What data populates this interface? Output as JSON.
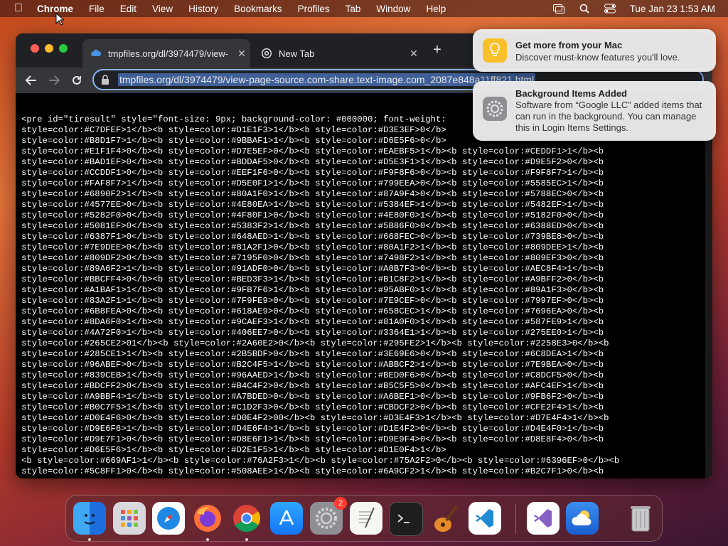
{
  "menubar": {
    "app": "Chrome",
    "items": [
      "File",
      "Edit",
      "View",
      "History",
      "Bookmarks",
      "Profiles",
      "Tab",
      "Window",
      "Help"
    ],
    "clock": "Tue Jan 23  1:53 AM"
  },
  "browser": {
    "tabs": [
      {
        "title": "tmpfiles.org/dl/3974479/view-",
        "close": "✕"
      },
      {
        "title": "New Tab",
        "close": "✕"
      }
    ],
    "new_tab": "+",
    "url": "tmpfiles.org/dl/3974479/view-page-source.com-share.text-image.com_2087e848a11ff821.html"
  },
  "source_lines": [
    "<pre id=\"tiresult\" style=\"font-size: 9px; background-color: #000000; font-weight:",
    "style=color:#C7DFEF>1</b><b style=color:#D1E1F3>1</b><b style=color:#D3E3EF>0</b>",
    "style=color:#B8D1F7>1</b><b style=color:#9BBAF1>1</b><b style=color:#D6E5F6>0</b>",
    "style=color:#E1F1F4>0</b><b style=color:#D7E5EF>0</b><b style=color:#EAEBF5>1</b><b style=color:#CEDDF1>1</b><b",
    "style=color:#BAD1EF>0</b><b style=color:#BDDAF5>0</b><b style=color:#D5E3F1>1</b><b style=color:#D9E5F2>0</b><b",
    "style=color:#CCDDF1>0</b><b style=color:#EEF1F6>0</b><b style=color:#F9F8F6>0</b><b style=color:#F9F8F7>1</b><b",
    "style=color:#FAF8F7>1</b><b style=color:#D5E0F1>1</b><b style=color:#799EEA>0</b><b style=color:#5585EC>1</b><b",
    "style=color:#6890F2>1</b><b style=color:#80A1F0>1</b><b style=color:#87A9F4>0</b><b style=color:#5788EC>0</b><b",
    "style=color:#4577EE>0</b><b style=color:#4E80EA>1</b><b style=color:#5384EF>1</b><b style=color:#5482EF>1</b><b",
    "style=color:#5282F0>0</b><b style=color:#4F80F1>0</b><b style=color:#4E80F0>1</b><b style=color:#5182F0>0</b><b",
    "style=color:#5081EF>0</b><b style=color:#5383F2>1</b><b style=color:#5B86F0>0</b><b style=color:#6388ED>0</b><b",
    "style=color:#6387F1>0</b><b style=color:#648AED>1</b><b style=color:#668FEC>0</b><b style=color:#739BE8>0</b><b",
    "style=color:#7E9DEE>0</b><b style=color:#81A2F1>0</b><b style=color:#80A1F2>1</b><b style=color:#809DEE>1</b><b",
    "style=color:#809DF2>0</b><b style=color:#7195F0>0</b><b style=color:#7498F2>1</b><b style=color:#809EF3>0</b><b",
    "style=color:#89A6F2>1</b><b style=color:#91ADF0>0</b><b style=color:#A0B7F3>0</b><b style=color:#AEC8F4>1</b><b",
    "style=color:#BBCFF4>0</b><b style=color:#BED3F3>1</b><b style=color:#B1C8F2>1</b><b style=color:#A9BFF2>0</b><b",
    "style=color:#A1BAF1>1</b><b style=color:#9FB7F6>1</b><b style=color:#95ABF0>1</b><b style=color:#89A1F3>0</b><b",
    "style=color:#83A2F1>1</b><b style=color:#7F9FE9>0</b><b style=color:#7E9CEF>0</b><b style=color:#7997EF>0</b><b",
    "style=color:#6B8FEA>0</b><b style=color:#618AE9>0</b><b style=color:#658CEC>1</b><b style=color:#7696EA>0</b><b",
    "style=color:#8DA6F0>1</b><b style=color:#9CAEF3>1</b><b style=color:#81A0F0>1</b><b style=color:#587FE9>1</b><b",
    "style=color:#4A72F0>1</b><b style=color:#406EE7>0</b><b style=color:#3364E1>1</b><b style=color:#275EE0>1</b><b",
    "style=color:#265CE2>01</b><b style=color:#2A60E2>0</b><b style=color:#295FE2>1</b><b style=color:#2258E3>0</b><b",
    "style=color:#285CE1>1</b><b style=color:#2B5BDF>0</b><b style=color:#3E69E6>0</b><b style=color:#6C8DEA>1</b><b",
    "style=color:#96ABEF>0</b><b style=color:#B2C4F5>1</b><b style=color:#ABBCF2>1</b><b style=color:#7E9BEA>0</b><b",
    "style=color:#839CEB>1</b><b style=color:#96AAED>1</b><b style=color:#BED0F6>0</b><b style=color:#C8DCF5>0</b><b",
    "style=color:#BDCFF2>0</b><b style=color:#B4C4F2>0</b><b style=color:#B5C5F5>0</b><b style=color:#AFC4EF>1</b><b",
    "style=color:#A9BBF4>1</b><b style=color:#A7BDED>0</b><b style=color:#A6BEF1>0</b><b style=color:#9FB6F2>0</b><b",
    "style=color:#B0C7F5>1</b><b style=color:#C1D2F3>0</b><b style=color:#CBDCF2>0</b><b style=color:#CFE2F4>1</b><b",
    "style=color:#D0E4F6>0</b><b style=color:#D0E4F2>00</b><b style=color:#D3E4F3>1</b><b style=color:#D7E4F4>1</b><b",
    "style=color:#D9E6F6>1</b><b style=color:#D4E6F4>1</b><b style=color:#D1E4F2>0</b><b style=color:#D4E4F0>1</b><b",
    "style=color:#D9E7F1>0</b><b style=color:#D8E6F1>1</b><b style=color:#D9E9F4>0</b><b style=color:#D8E8F4>0</b><b",
    "style=color:#D6E5F6>1</b><b style=color:#D2E1F5>1</b><b style=color:#D1E0F4>1</b>",
    "<b style=color:#669AF1>1</b><b style=color:#76A2F3>1</b><b style=color:#75A2F2>0</b><b style=color:#6396EF>0</b><b",
    "style=color:#5C8FF1>0</b><b style=color:#508AEE>1</b><b style=color:#6A9CF2>1</b><b style=color:#B2C7F1>0</b><b"
  ],
  "notifications": [
    {
      "title": "Get more from your Mac",
      "body": "Discover must-know features you'll love."
    },
    {
      "title": "Background Items Added",
      "body": "Software from “Google LLC” added items that can run in the background. You can manage this in Login Items Settings."
    }
  ],
  "dock": {
    "apps": [
      "finder",
      "launchpad",
      "safari",
      "firefox",
      "chrome",
      "app-store",
      "system-settings",
      "textedit",
      "terminal",
      "garageband",
      "vscode",
      "visual-studio",
      "weather",
      "trash"
    ],
    "settings_badge": "2"
  }
}
